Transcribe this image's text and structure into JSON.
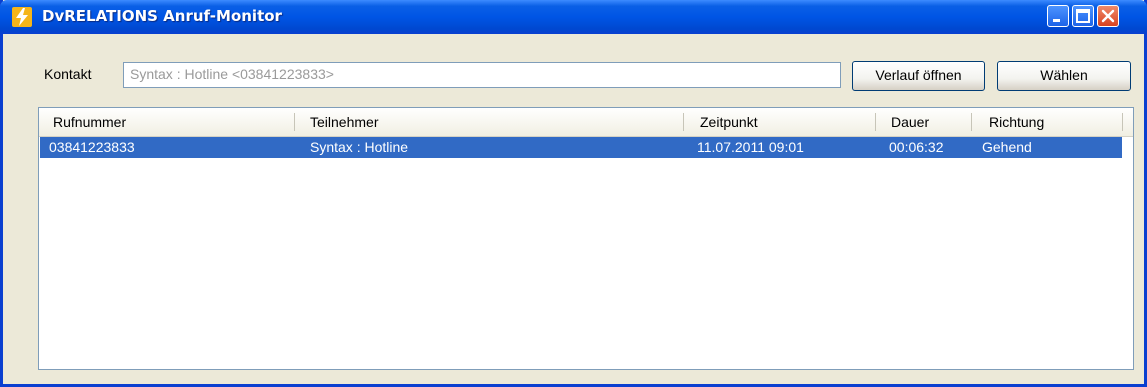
{
  "window": {
    "title": "DvRELATIONS Anruf-Monitor",
    "icon": "app-lightning-icon",
    "controls": [
      "minimize-icon",
      "maximize-icon",
      "close-icon"
    ]
  },
  "form": {
    "kontakt_label": "Kontakt",
    "kontakt_value": "Syntax : Hotline <03841223833>",
    "verlauf_button": "Verlauf öffnen",
    "waehlen_button": "Wählen"
  },
  "table": {
    "columns": [
      "Rufnummer",
      "Teilnehmer",
      "Zeitpunkt",
      "Dauer",
      "Richtung"
    ],
    "rows": [
      {
        "rufnummer": "03841223833",
        "teilnehmer": "Syntax : Hotline",
        "zeitpunkt": "11.07.2011 09:01",
        "dauer": "00:06:32",
        "richtung": "Gehend",
        "selected": true
      }
    ]
  },
  "colors": {
    "titlebar": "#0055e5",
    "selection": "#316ac5",
    "window_bg": "#ece9d8",
    "close_button": "#d84320"
  }
}
